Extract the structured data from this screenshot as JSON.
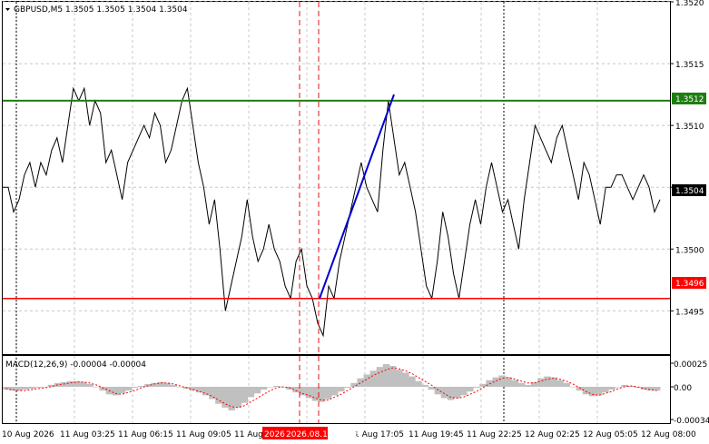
{
  "chart_data": [
    {
      "type": "line",
      "symbol": "GBPUSD",
      "timeframe": "M5",
      "header": "GBPUSD,M5  1.3505 1.3505 1.3504 1.3504",
      "ohlc": {
        "open": 1.3505,
        "high": 1.3505,
        "low": 1.3504,
        "close": 1.3504
      },
      "ylim": [
        1.34915,
        1.352
      ],
      "y_ticks": [
        "1.3520",
        "1.3515",
        "1.3510",
        "1.3505",
        "1.3500",
        "1.3495"
      ],
      "x_ticks": [
        "10 Aug 2026",
        "11 Aug 03:25",
        "11 Aug 06:15",
        "11 Aug 09:05",
        "11 Aug",
        "1 Aug 17:05",
        "11 Aug 19:45",
        "11 Aug 22:25",
        "12 Aug 02:25",
        "12 Aug 05:05",
        "12 Aug 08:00"
      ],
      "crosshair_label": "2026.08.11 15:35",
      "crosshair_label_partial": "2026",
      "levels": [
        {
          "name": "resistance",
          "value": 1.3512,
          "label": "1.3512",
          "color": "#1e7d12"
        },
        {
          "name": "support",
          "value": 1.3496,
          "label": "1.3496",
          "color": "#ff0000"
        }
      ],
      "current_price_label": "1.3504",
      "trend_line": {
        "from": 1.3496,
        "to": 1.35125,
        "color": "#0000cc"
      },
      "line_color": "#000000",
      "grid": true,
      "series": [
        {
          "values": [
            1.3505,
            1.3505,
            1.3503,
            1.3504,
            1.3506,
            1.3507,
            1.3505,
            1.3507,
            1.3506,
            1.3508,
            1.3509,
            1.3507,
            1.351,
            1.3513,
            1.3512,
            1.3513,
            1.351,
            1.3512,
            1.3511,
            1.3507,
            1.3508,
            1.3506,
            1.3504,
            1.3507,
            1.3508,
            1.3509,
            1.351,
            1.3509,
            1.3511,
            1.351,
            1.3507,
            1.3508,
            1.351,
            1.3512,
            1.3513,
            1.351,
            1.3507,
            1.3505,
            1.3502,
            1.3504,
            1.35,
            1.3495,
            1.3497,
            1.3499,
            1.3501,
            1.3504,
            1.3501,
            1.3499,
            1.35,
            1.3502,
            1.35,
            1.3499,
            1.3497,
            1.3496,
            1.3499,
            1.35,
            1.3497,
            1.3496,
            1.3494,
            1.3493,
            1.3497,
            1.3496,
            1.3499,
            1.3501,
            1.3503,
            1.3505,
            1.3507,
            1.3505,
            1.3504,
            1.3503,
            1.3508,
            1.3512,
            1.3509,
            1.3506,
            1.3507,
            1.3505,
            1.3503,
            1.35,
            1.3497,
            1.3496,
            1.3499,
            1.3503,
            1.3501,
            1.3498,
            1.3496,
            1.3499,
            1.3502,
            1.3504,
            1.3502,
            1.3505,
            1.3507,
            1.3505,
            1.3503,
            1.3504,
            1.3502,
            1.35,
            1.3504,
            1.3507,
            1.351,
            1.3509,
            1.3508,
            1.3507,
            1.3509,
            1.351,
            1.3508,
            1.3506,
            1.3504,
            1.3507,
            1.3506,
            1.3504,
            1.3502,
            1.3505,
            1.3505,
            1.3506,
            1.3506,
            1.3505,
            1.3504,
            1.3505,
            1.3506,
            1.3505,
            1.3503,
            1.3504
          ]
        }
      ]
    },
    {
      "type": "bar",
      "indicator": "MACD(12,26,9)",
      "header": "MACD(12,26,9) -0.00004 -0.00004",
      "main_value": -4e-05,
      "signal_value": -4e-05,
      "ylim": [
        -3.4e-05,
        2.5e-05
      ],
      "y_ticks": [
        "0.00025",
        "0.00",
        "-0.00034"
      ],
      "histogram_color": "#c0c0c0",
      "signal_color": "#ff0000",
      "series": [
        {
          "values": [
            -3e-05,
            -4e-05,
            -4e-05,
            -3e-05,
            -2e-05,
            -1e-05,
            0.0,
            2e-05,
            4e-05,
            5e-05,
            6e-05,
            6e-05,
            5e-05,
            3e-05,
            0.0,
            -4e-05,
            -8e-05,
            -9e-05,
            -7e-05,
            -4e-05,
            -1e-05,
            1e-05,
            3e-05,
            4e-05,
            5e-05,
            4e-05,
            2e-05,
            0.0,
            -2e-05,
            -4e-05,
            -6e-05,
            -9e-05,
            -0.00013,
            -0.00018,
            -0.00022,
            -0.00025,
            -0.00022,
            -0.00017,
            -0.00011,
            -7e-05,
            -3e-05,
            0.0,
            1e-05,
            0.0,
            -3e-05,
            -6e-05,
            -9e-05,
            -0.00012,
            -0.00015,
            -0.00016,
            -0.00013,
            -9e-05,
            -5e-05,
            -1e-05,
            4e-05,
            9e-05,
            0.00013,
            0.00017,
            0.00021,
            0.00024,
            0.00022,
            0.00018,
            0.00015,
            0.00011,
            6e-05,
            2e-05,
            -3e-05,
            -8e-05,
            -0.00012,
            -0.00014,
            -0.00012,
            -9e-05,
            -5e-05,
            -1e-05,
            3e-05,
            7e-05,
            0.0001,
            0.00012,
            0.0001,
            7e-05,
            4e-05,
            2e-05,
            5e-05,
            9e-05,
            0.00011,
            0.0001,
            7e-05,
            4e-05,
            0.0,
            -4e-05,
            -8e-05,
            -0.0001,
            -9e-05,
            -6e-05,
            -3e-05,
            0.0,
            2e-05,
            1e-05,
            -1e-05,
            -3e-05,
            -4e-05,
            -4e-05
          ]
        },
        {
          "values": [
            -2e-05,
            -3e-05,
            -4e-05,
            -4e-05,
            -3e-05,
            -2e-05,
            -1e-05,
            0.0,
            2e-05,
            3e-05,
            4e-05,
            5e-05,
            5e-05,
            4e-05,
            2e-05,
            -1e-05,
            -4e-05,
            -7e-05,
            -8e-05,
            -6e-05,
            -4e-05,
            -1e-05,
            1e-05,
            3e-05,
            4e-05,
            4e-05,
            3e-05,
            1e-05,
            -1e-05,
            -3e-05,
            -5e-05,
            -7e-05,
            -0.0001,
            -0.00014,
            -0.00018,
            -0.00021,
            -0.00022,
            -0.0002,
            -0.00016,
            -0.00012,
            -8e-05,
            -4e-05,
            -1e-05,
            0.0,
            -1e-05,
            -4e-05,
            -7e-05,
            -9e-05,
            -0.00012,
            -0.00014,
            -0.00014,
            -0.00011,
            -8e-05,
            -4e-05,
            0.0,
            4e-05,
            8e-05,
            0.00012,
            0.00015,
            0.00018,
            0.0002,
            0.00019,
            0.00017,
            0.00014,
            0.0001,
            6e-05,
            2e-05,
            -3e-05,
            -7e-05,
            -0.00011,
            -0.00012,
            -0.00011,
            -8e-05,
            -5e-05,
            -1e-05,
            3e-05,
            6e-05,
            9e-05,
            0.0001,
            8e-05,
            6e-05,
            4e-05,
            4e-05,
            6e-05,
            8e-05,
            9e-05,
            8e-05,
            6e-05,
            3e-05,
            -1e-05,
            -5e-05,
            -8e-05,
            -9e-05,
            -7e-05,
            -5e-05,
            -2e-05,
            0.0,
            1e-05,
            0.0,
            -2e-05,
            -3e-05,
            -4e-05
          ]
        }
      ]
    }
  ]
}
